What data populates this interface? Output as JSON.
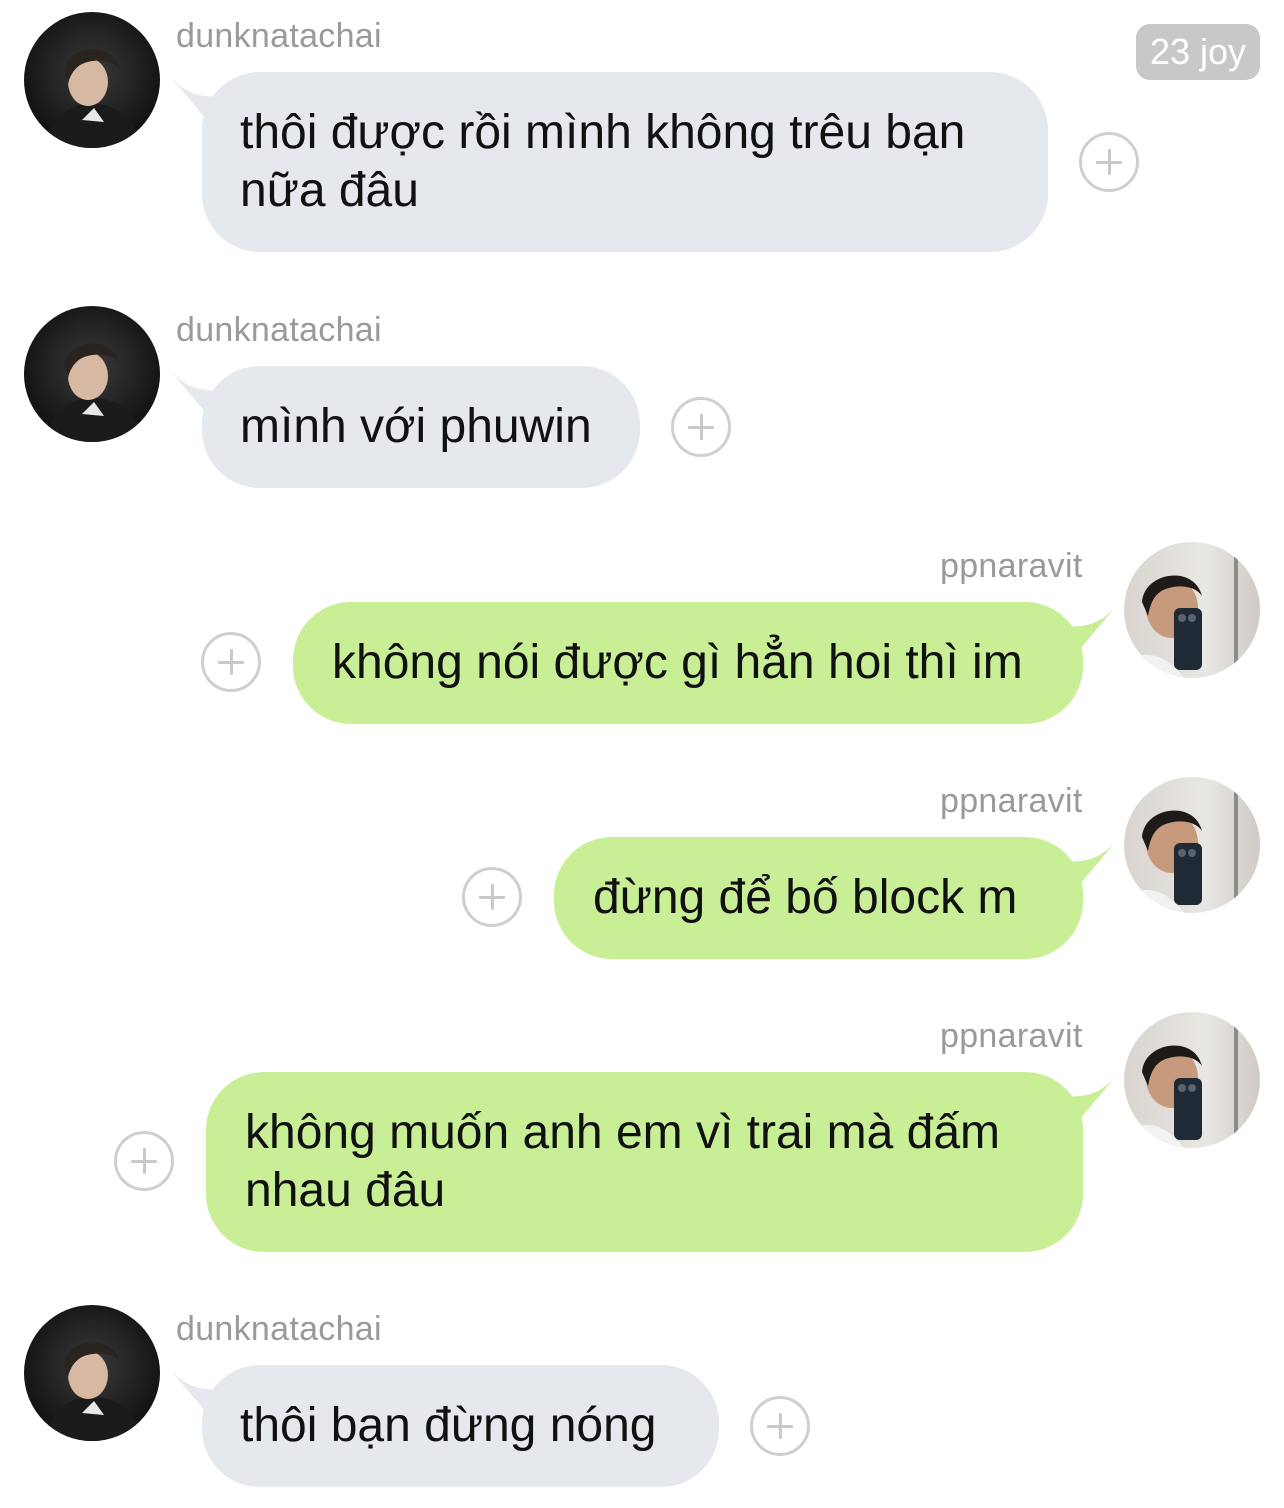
{
  "time_badge": "23 joy",
  "colors": {
    "incoming_bubble": "#e5e8ec",
    "outgoing_bubble": "#c8ef96",
    "sender_text": "#9a9a9a",
    "background": "#ffffff"
  },
  "messages": [
    {
      "sender": "dunknatachai",
      "direction": "incoming",
      "lines": [
        "thôi được rồi mình không trêu bạn",
        "nữa đâu"
      ],
      "react_icon": "add-reaction-icon"
    },
    {
      "sender": "dunknatachai",
      "direction": "incoming",
      "lines": [
        "mình với phuwin"
      ],
      "react_icon": "add-reaction-icon"
    },
    {
      "sender": "ppnaravit",
      "direction": "outgoing",
      "lines": [
        "không nói được gì hẳn hoi thì im"
      ],
      "react_icon": "add-reaction-icon"
    },
    {
      "sender": "ppnaravit",
      "direction": "outgoing",
      "lines": [
        "đừng để bố block m"
      ],
      "react_icon": "add-reaction-icon"
    },
    {
      "sender": "ppnaravit",
      "direction": "outgoing",
      "lines": [
        "không muốn anh em vì trai mà đấm",
        "nhau đâu"
      ],
      "react_icon": "add-reaction-icon"
    },
    {
      "sender": "dunknatachai",
      "direction": "incoming",
      "lines": [
        "thôi bạn đừng nóng"
      ],
      "react_icon": "add-reaction-icon"
    }
  ]
}
